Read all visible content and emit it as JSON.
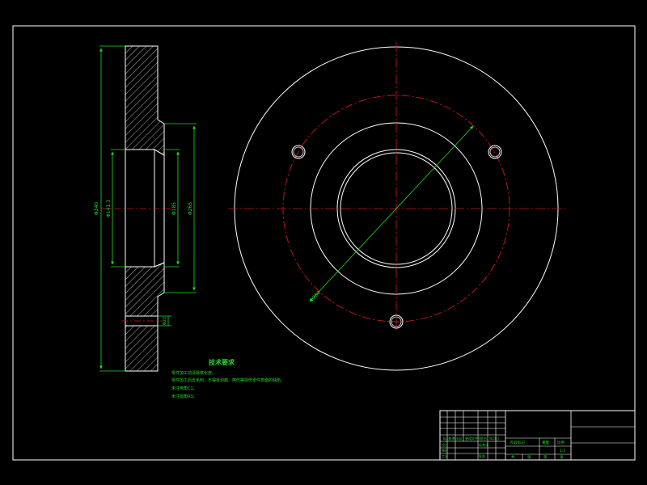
{
  "drawing": {
    "colors": {
      "background": "#000000",
      "outline": "#ffffff",
      "centerline": "#d01818",
      "dimension": "#22dd22",
      "hatch": "#ffffff"
    }
  },
  "section_view": {
    "dim_outer_diameter": "Φ340",
    "dim_bore": "Φ141.3",
    "dim_hub_inner": "Φ185",
    "dim_hub_outer": "Φ265",
    "dim_bolt_hole": "Φ22"
  },
  "plan_view": {
    "dim_bolt_circle": "Φ280",
    "bolt_hole_count": 3
  },
  "tech_notes": {
    "title": "技术要求",
    "items": [
      "零件加工前清除氧化皮。",
      "零件加工后去毛刺，不得有划痕、擦伤等损伤零件表面的缺陷。",
      "未注倒角C1。",
      "未注圆角R3。"
    ]
  },
  "title_block": {
    "row_labels": [
      "标记",
      "处数",
      "分区",
      "更改文件号",
      "签名",
      "年月日"
    ],
    "design_label": "设计",
    "standardize_label": "标准化",
    "review_label": "审核",
    "process_label": "工艺",
    "approve_label": "批准",
    "stage_mark_label": "阶段标记",
    "weight_label": "重量",
    "scale_label": "比例",
    "scale_value": "1:1",
    "sheet_marks": [
      "共",
      "张",
      "第",
      "张"
    ]
  }
}
